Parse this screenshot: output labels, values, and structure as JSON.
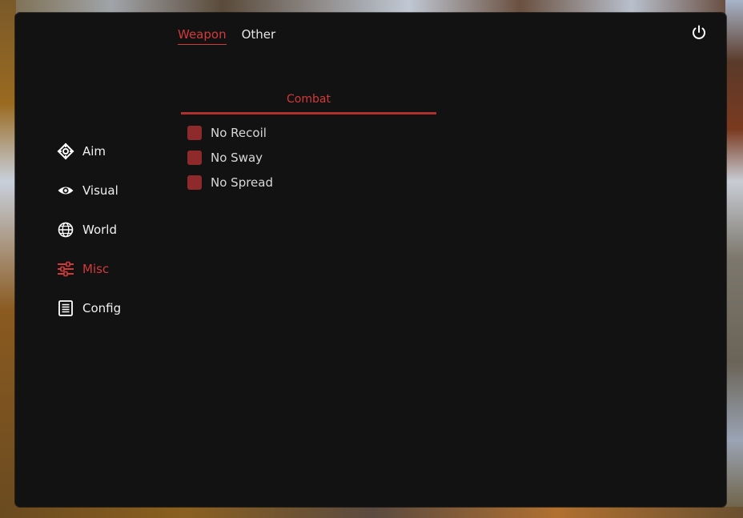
{
  "top_tabs": [
    {
      "label": "Weapon",
      "active": true
    },
    {
      "label": "Other",
      "active": false
    }
  ],
  "sidebar": {
    "items": [
      {
        "label": "Aim",
        "icon": "crosshair-icon",
        "active": false
      },
      {
        "label": "Visual",
        "icon": "eye-icon",
        "active": false
      },
      {
        "label": "World",
        "icon": "globe-icon",
        "active": false
      },
      {
        "label": "Misc",
        "icon": "sliders-icon",
        "active": true
      },
      {
        "label": "Config",
        "icon": "document-icon",
        "active": false
      }
    ]
  },
  "section": {
    "title": "Combat",
    "options": [
      {
        "label": "No Recoil",
        "checked": true
      },
      {
        "label": "No Sway",
        "checked": true
      },
      {
        "label": "No Spread",
        "checked": true
      }
    ]
  },
  "colors": {
    "accent": "#d23a3a",
    "checkbox": "#8e2a2c",
    "panel": "#121213",
    "text": "#f0f0f0"
  },
  "icons": {
    "power": "power-icon"
  }
}
